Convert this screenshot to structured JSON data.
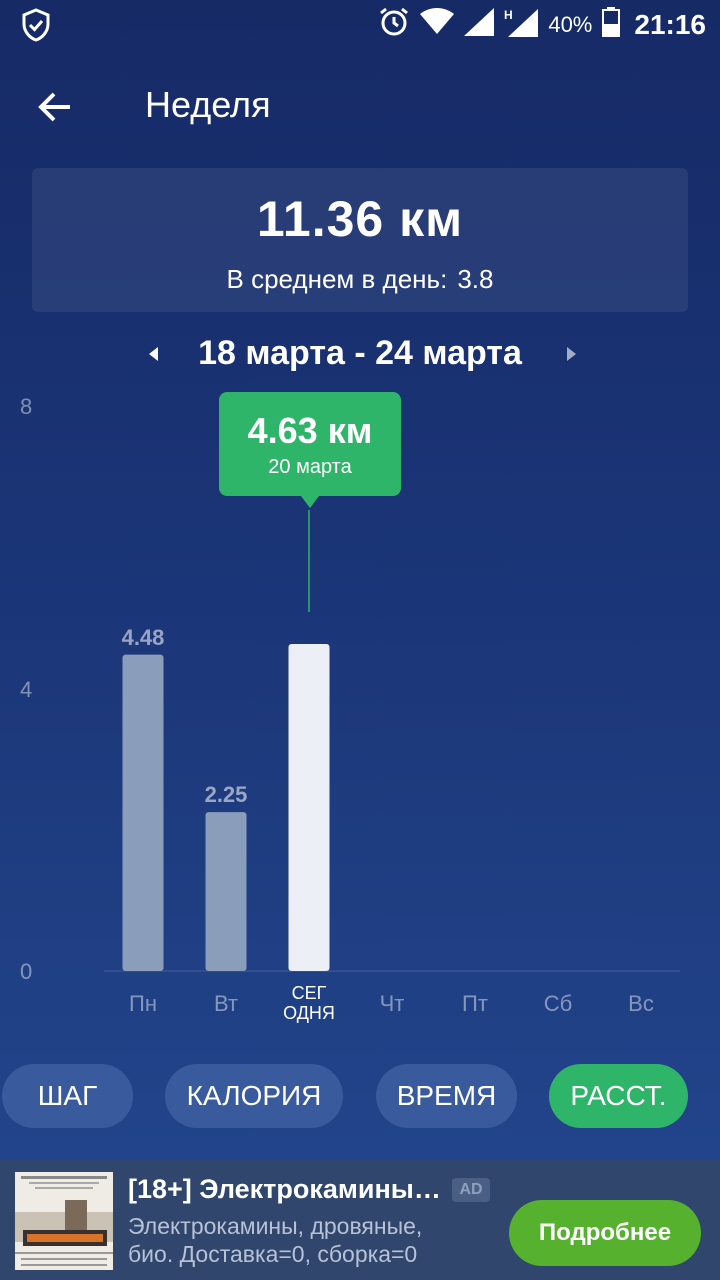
{
  "status_bar": {
    "battery_percent": "40%",
    "time": "21:16",
    "network": "H"
  },
  "header": {
    "title": "Неделя"
  },
  "summary": {
    "total": "11.36 км",
    "avg_label": "В среднем в день:",
    "avg_value": "3.8"
  },
  "date_range": {
    "label": "18 марта - 24 марта"
  },
  "tooltip": {
    "value": "4.63 км",
    "date": "20 марта"
  },
  "chart_data": {
    "type": "bar",
    "categories": [
      "Пн",
      "Вт",
      "СЕГ\nОДНЯ",
      "Чт",
      "Пт",
      "Сб",
      "Вс"
    ],
    "category_labels": [
      "Пн",
      "Вт",
      "СЕГ",
      "Чт",
      "Пт",
      "Сб",
      "Вс"
    ],
    "today_label_line2": "ОДНЯ",
    "values": [
      4.48,
      2.25,
      4.63,
      null,
      null,
      null,
      null
    ],
    "value_labels": [
      "4.48",
      "2.25",
      "",
      "",
      "",
      "",
      ""
    ],
    "y_ticks": [
      "8",
      "4",
      "0"
    ],
    "ylim": [
      0,
      8
    ],
    "highlight_index": 2,
    "colors": {
      "bar": "#8a9ebb",
      "highlight": "#eceff5",
      "marker": "#2fb56a"
    }
  },
  "tabs": [
    {
      "label": "ШАГ",
      "active": false
    },
    {
      "label": "КАЛОРИЯ",
      "active": false
    },
    {
      "label": "ВРЕМЯ",
      "active": false
    },
    {
      "label": "РАССТ.",
      "active": true
    }
  ],
  "ad": {
    "title": "[18+] Электрокамины…",
    "badge": "AD",
    "description": "Электрокамины, дровяные, био. Доставка=0, сборка=0",
    "cta": "Подробнее"
  },
  "icons": [
    "shield-icon",
    "alarm-icon",
    "wifi-icon",
    "signal-icon",
    "battery-icon",
    "back-arrow-icon",
    "chevron-left-icon",
    "chevron-right-icon"
  ]
}
